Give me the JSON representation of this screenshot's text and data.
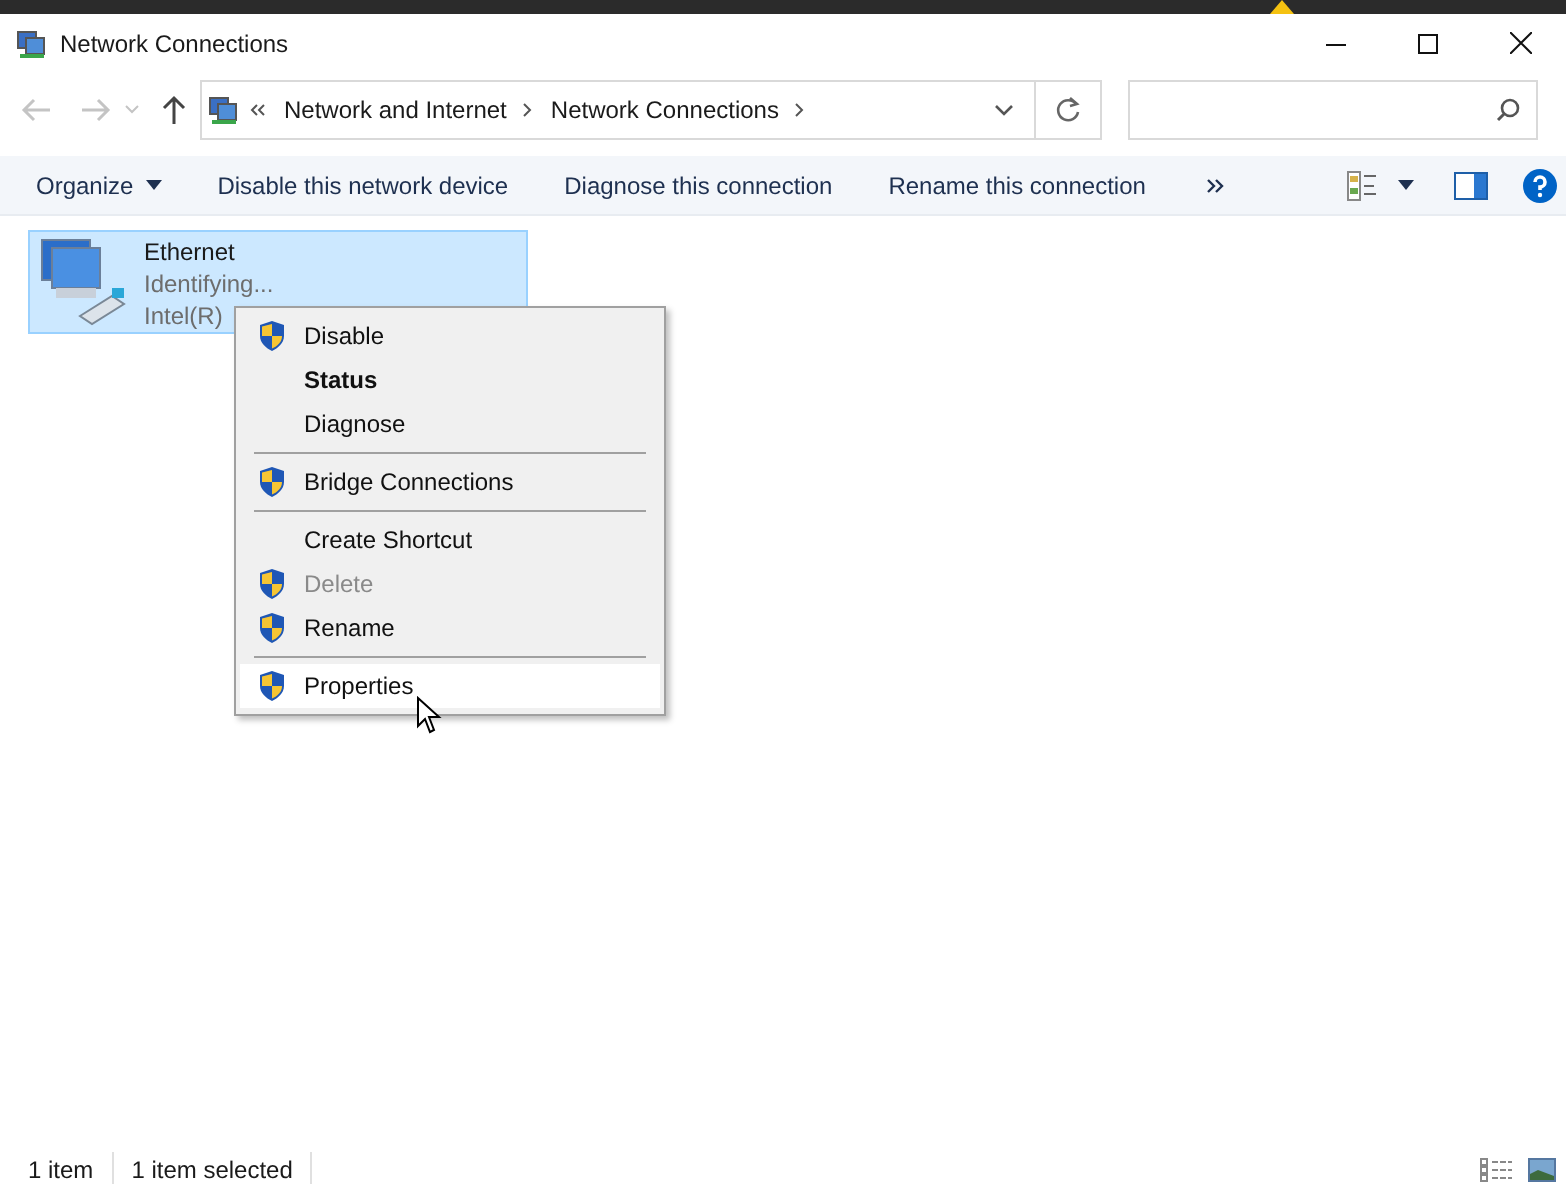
{
  "window": {
    "title": "Network Connections"
  },
  "address": {
    "segments": [
      "Network and Internet",
      "Network Connections"
    ]
  },
  "command_bar": [
    "Organize",
    "Disable this network device",
    "Diagnose this connection",
    "Rename this connection"
  ],
  "connection": {
    "name": "Ethernet",
    "status": "Identifying...",
    "device": "Intel(R)",
    "selected": true
  },
  "context_menu": [
    {
      "kind": "item",
      "label": "Disable",
      "shield": true,
      "bold": false,
      "disabled": false,
      "selected": false
    },
    {
      "kind": "item",
      "label": "Status",
      "shield": false,
      "bold": true,
      "disabled": false,
      "selected": false
    },
    {
      "kind": "item",
      "label": "Diagnose",
      "shield": false,
      "bold": false,
      "disabled": false,
      "selected": false
    },
    {
      "kind": "separator"
    },
    {
      "kind": "item",
      "label": "Bridge Connections",
      "shield": true,
      "bold": false,
      "disabled": false,
      "selected": false
    },
    {
      "kind": "separator"
    },
    {
      "kind": "item",
      "label": "Create Shortcut",
      "shield": false,
      "bold": false,
      "disabled": false,
      "selected": false
    },
    {
      "kind": "item",
      "label": "Delete",
      "shield": true,
      "bold": false,
      "disabled": true,
      "selected": false
    },
    {
      "kind": "item",
      "label": "Rename",
      "shield": true,
      "bold": false,
      "disabled": false,
      "selected": false
    },
    {
      "kind": "separator"
    },
    {
      "kind": "item",
      "label": "Properties",
      "shield": true,
      "bold": false,
      "disabled": false,
      "selected": true
    }
  ],
  "status_bar": [
    "1 item",
    "1 item selected"
  ]
}
